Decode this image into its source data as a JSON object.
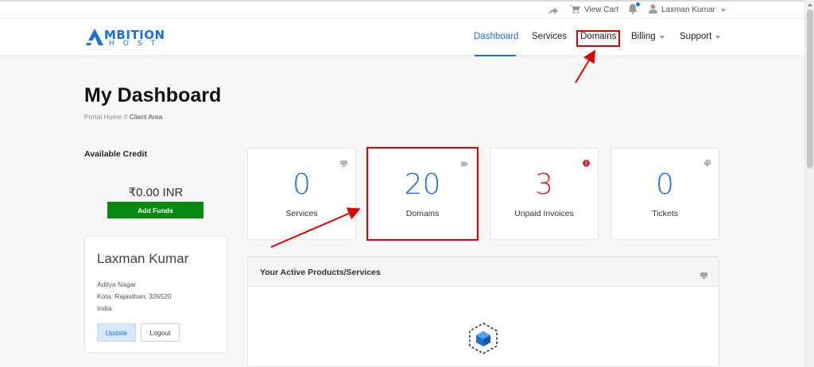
{
  "topbar": {
    "view_cart_label": "View Cart",
    "user_name": "Laxman Kumar"
  },
  "brand": {
    "logo_word": "MBITION",
    "logo_sub": "HOST",
    "color": "#1b6fd6"
  },
  "nav": {
    "items": [
      {
        "label": "Dashboard",
        "active": true
      },
      {
        "label": "Services"
      },
      {
        "label": "Domains"
      },
      {
        "label": "Billing"
      },
      {
        "label": "Support"
      }
    ]
  },
  "page": {
    "title": "My Dashboard",
    "breadcrumb": {
      "home": "Portal Home",
      "separator": "//",
      "current": "Client Area"
    }
  },
  "credit": {
    "heading": "Available Credit",
    "amount": "₹0.00 INR",
    "add_funds_label": "Add Funds",
    "button_color": "#0a8a12"
  },
  "profile": {
    "name": "Laxman Kumar",
    "address": [
      "Aditya Nagar",
      "Kota, Rajasthan, 326520",
      "India"
    ],
    "update_label": "Update",
    "logout_label": "Logout"
  },
  "stats": [
    {
      "value": "0",
      "label": "Services",
      "color": "#1b6fd6",
      "icon": "monitor-icon"
    },
    {
      "value": "20",
      "label": "Domains",
      "color": "#1b6fd6",
      "icon": "tag-icon"
    },
    {
      "value": "3",
      "label": "Unpaid Invoices",
      "color": "#d9232d",
      "icon": "alert-icon"
    },
    {
      "value": "0",
      "label": "Tickets",
      "color": "#1b6fd6",
      "icon": "ticket-icon"
    }
  ],
  "products_panel": {
    "title": "Your Active Products/Services"
  },
  "annotation_color": "#dd0000"
}
